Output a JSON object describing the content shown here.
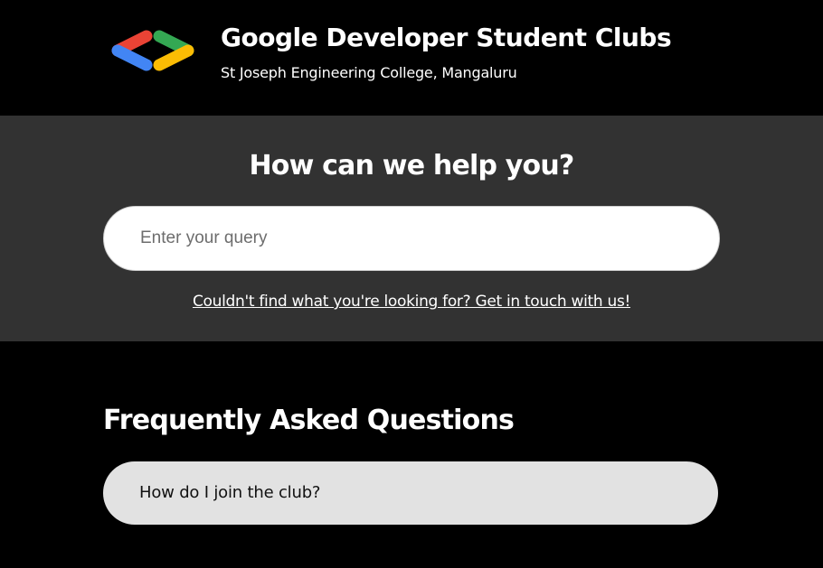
{
  "colors": {
    "header_bg": "#000000",
    "help_bg": "#323232",
    "faq_item_bg": "#e2e2e2",
    "logo_red": "#ea4335",
    "logo_blue": "#4285f4",
    "logo_green": "#34a853",
    "logo_yellow": "#fbbc04"
  },
  "header": {
    "logo_icon": "gdsc-brackets-logo",
    "title": "Google Developer Student Clubs",
    "subtitle": "St Joseph Engineering College, Mangaluru"
  },
  "help": {
    "title": "How can we help you?",
    "search": {
      "placeholder": "Enter your query",
      "value": ""
    },
    "contact_link": "Couldn't find what you're looking for? Get in touch with us!"
  },
  "faq": {
    "title": "Frequently Asked Questions",
    "items": [
      {
        "question": "How do I join the club?"
      }
    ]
  }
}
